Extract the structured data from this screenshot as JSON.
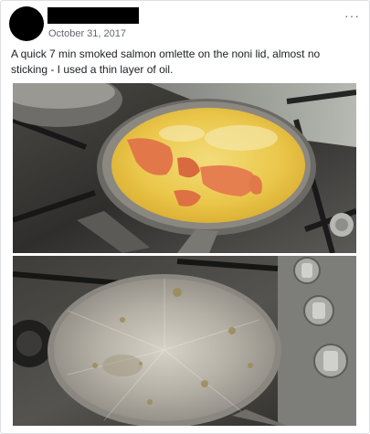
{
  "post": {
    "author_name": "",
    "timestamp": "October 31, 2017",
    "more_options_glyph": "···",
    "caption": "A quick 7 min smoked salmon omlette on the noni lid, almost no sticking - I used a thin layer of oil.",
    "photos": [
      {
        "icon": "omelette-in-pan-photo"
      },
      {
        "icon": "empty-pan-lid-photo"
      }
    ]
  },
  "colors": {
    "text": "#1c1e21",
    "meta": "#616770",
    "border": "#dddfe2",
    "egg": "#eac94a",
    "salmon": "#e2774a"
  }
}
